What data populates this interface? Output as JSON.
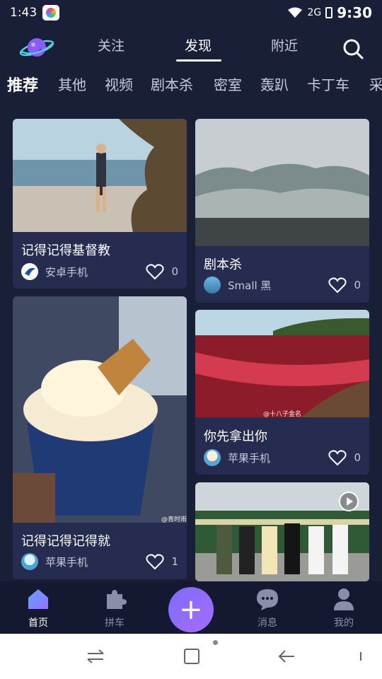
{
  "status_bar": {
    "time": "1:43",
    "network": "2G",
    "battery_percent": "",
    "clock_right": "9:30"
  },
  "top_tabs": [
    "关注",
    "发现",
    "附近"
  ],
  "active_top_tab": "发现",
  "categories": [
    "推荐",
    "其他",
    "视频",
    "剧本杀",
    "密室",
    "轰趴",
    "卡丁车",
    "采"
  ],
  "active_category": "推荐",
  "feed": {
    "left": [
      {
        "title": "记得记得基督教",
        "author": "安卓手机",
        "likes": "0",
        "image": "beach-rock-photo"
      },
      {
        "title": "记得记得记得就",
        "author": "苹果手机",
        "likes": "1",
        "image": "ice-cream-cup-photo",
        "watermark": "@青时雨"
      }
    ],
    "right": [
      {
        "title": "剧本杀",
        "author": "Small 黑",
        "likes": "0",
        "image": "misty-mountains-photo"
      },
      {
        "title": "你先拿出你",
        "author": "苹果手机",
        "likes": "0",
        "image": "red-sea-beach-photo",
        "watermark": "@十八子金名"
      },
      {
        "image": "train-group-photo",
        "has_video": true
      }
    ]
  },
  "bottom_nav": [
    {
      "label": "首页",
      "icon": "home-icon"
    },
    {
      "label": "拼车",
      "icon": "puzzle-icon"
    },
    {
      "label": "",
      "icon": "plus-icon"
    },
    {
      "label": "消息",
      "icon": "message-icon"
    },
    {
      "label": "我的",
      "icon": "profile-icon"
    }
  ],
  "colors": {
    "background": "#1a1f38",
    "card": "#252c4f",
    "accent": "#8f6dff",
    "nav_active": "#6b74f5"
  }
}
